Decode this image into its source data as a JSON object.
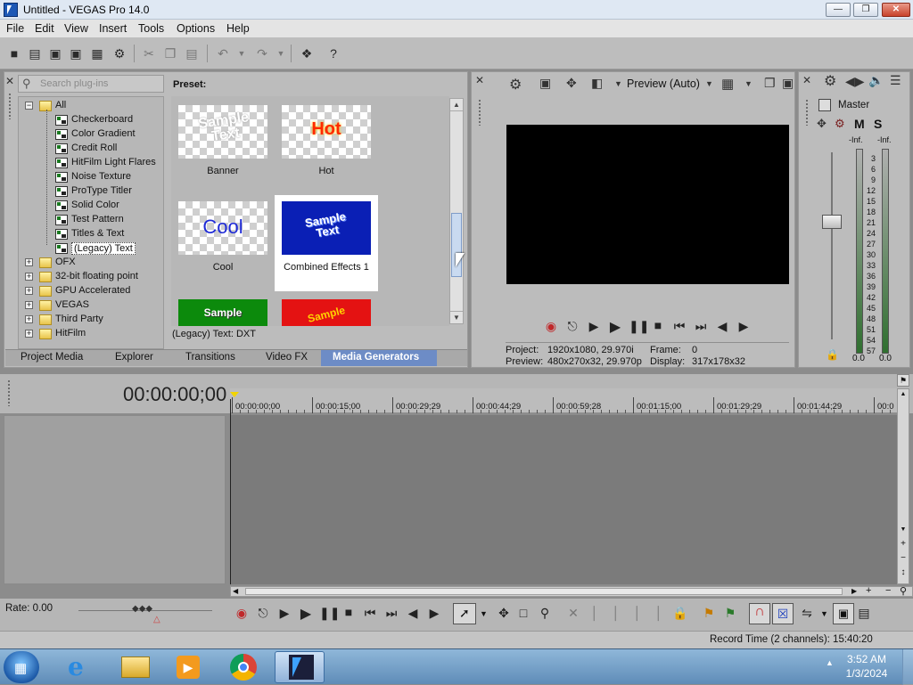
{
  "window": {
    "title": "Untitled - VEGAS Pro 14.0",
    "min": "—",
    "max": "❐",
    "close": "✕"
  },
  "menu": [
    "File",
    "Edit",
    "View",
    "Insert",
    "Tools",
    "Options",
    "Help"
  ],
  "toolbar_icons": [
    "new-icon",
    "open-icon",
    "save-icon",
    "save-as-icon",
    "render-icon",
    "properties-icon",
    "cut-icon",
    "copy-icon",
    "paste-icon",
    "undo-icon",
    "redo-icon",
    "plugin-icon",
    "help-icon"
  ],
  "generators": {
    "search_placeholder": "Search plug-ins",
    "preset_label": "Preset:",
    "status": "(Legacy) Text: DXT",
    "tree": [
      {
        "label": "All",
        "type": "folder",
        "expanded": true
      },
      {
        "label": "Checkerboard",
        "type": "gen"
      },
      {
        "label": "Color Gradient",
        "type": "gen"
      },
      {
        "label": "Credit Roll",
        "type": "gen"
      },
      {
        "label": "HitFilm Light Flares",
        "type": "gen"
      },
      {
        "label": "Noise Texture",
        "type": "gen"
      },
      {
        "label": "ProType Titler",
        "type": "gen"
      },
      {
        "label": "Solid Color",
        "type": "gen"
      },
      {
        "label": "Test Pattern",
        "type": "gen"
      },
      {
        "label": "Titles & Text",
        "type": "gen"
      },
      {
        "label": "(Legacy) Text",
        "type": "gen",
        "selected": true
      },
      {
        "label": "OFX",
        "type": "folder"
      },
      {
        "label": "32-bit floating point",
        "type": "folder"
      },
      {
        "label": "GPU Accelerated",
        "type": "folder"
      },
      {
        "label": "VEGAS",
        "type": "folder"
      },
      {
        "label": "Third Party",
        "type": "folder"
      },
      {
        "label": "HitFilm",
        "type": "folder"
      }
    ],
    "presets": [
      {
        "label": "Banner",
        "thumb_text": "Sample Text"
      },
      {
        "label": "Hot",
        "thumb_text": "Hot"
      },
      {
        "label": "Cool",
        "thumb_text": "Cool"
      },
      {
        "label": "Combined Effects 1",
        "thumb_text": "Sample Text",
        "selected": true
      },
      {
        "label": "",
        "thumb_text": "Sample"
      },
      {
        "label": "",
        "thumb_text": "Sample"
      }
    ]
  },
  "tabs": [
    "Project Media",
    "Explorer",
    "Transitions",
    "Video FX",
    "Media Generators"
  ],
  "active_tab": "Media Generators",
  "preview": {
    "mode": "Preview (Auto)",
    "project_label": "Project:",
    "project_value": "1920x1080, 29.970i",
    "frame_label": "Frame:",
    "frame_value": "0",
    "preview_label": "Preview:",
    "preview_value": "480x270x32, 29.970p",
    "display_label": "Display:",
    "display_value": "317x178x32"
  },
  "master": {
    "title": "Master",
    "m": "M",
    "s": "S",
    "inf_left": "-Inf.",
    "inf_right": "-Inf.",
    "scale": [
      "3",
      "6",
      "9",
      "12",
      "15",
      "18",
      "21",
      "24",
      "27",
      "30",
      "33",
      "36",
      "39",
      "42",
      "45",
      "48",
      "51",
      "54",
      "57"
    ],
    "left_value": "0.0",
    "right_value": "0.0"
  },
  "timeline": {
    "timecode": "00:00:00;00",
    "ruler_labels": [
      "00:00:00;00",
      "00:00:15;00",
      "00:00:29;29",
      "00:00:44;29",
      "00:00:59;28",
      "00:01:15;00",
      "00:01:29;29",
      "00:01:44;29",
      "00:0"
    ],
    "rate": "Rate: 0.00"
  },
  "status": {
    "record_time": "Record Time (2 channels): 15:40:20"
  },
  "taskbar": {
    "time": "3:52 AM",
    "date": "1/3/2024",
    "tray_arrow": "▲"
  },
  "colors": {
    "accent_blue": "#1a3dbd",
    "tab_active": "#6d8cc6"
  }
}
